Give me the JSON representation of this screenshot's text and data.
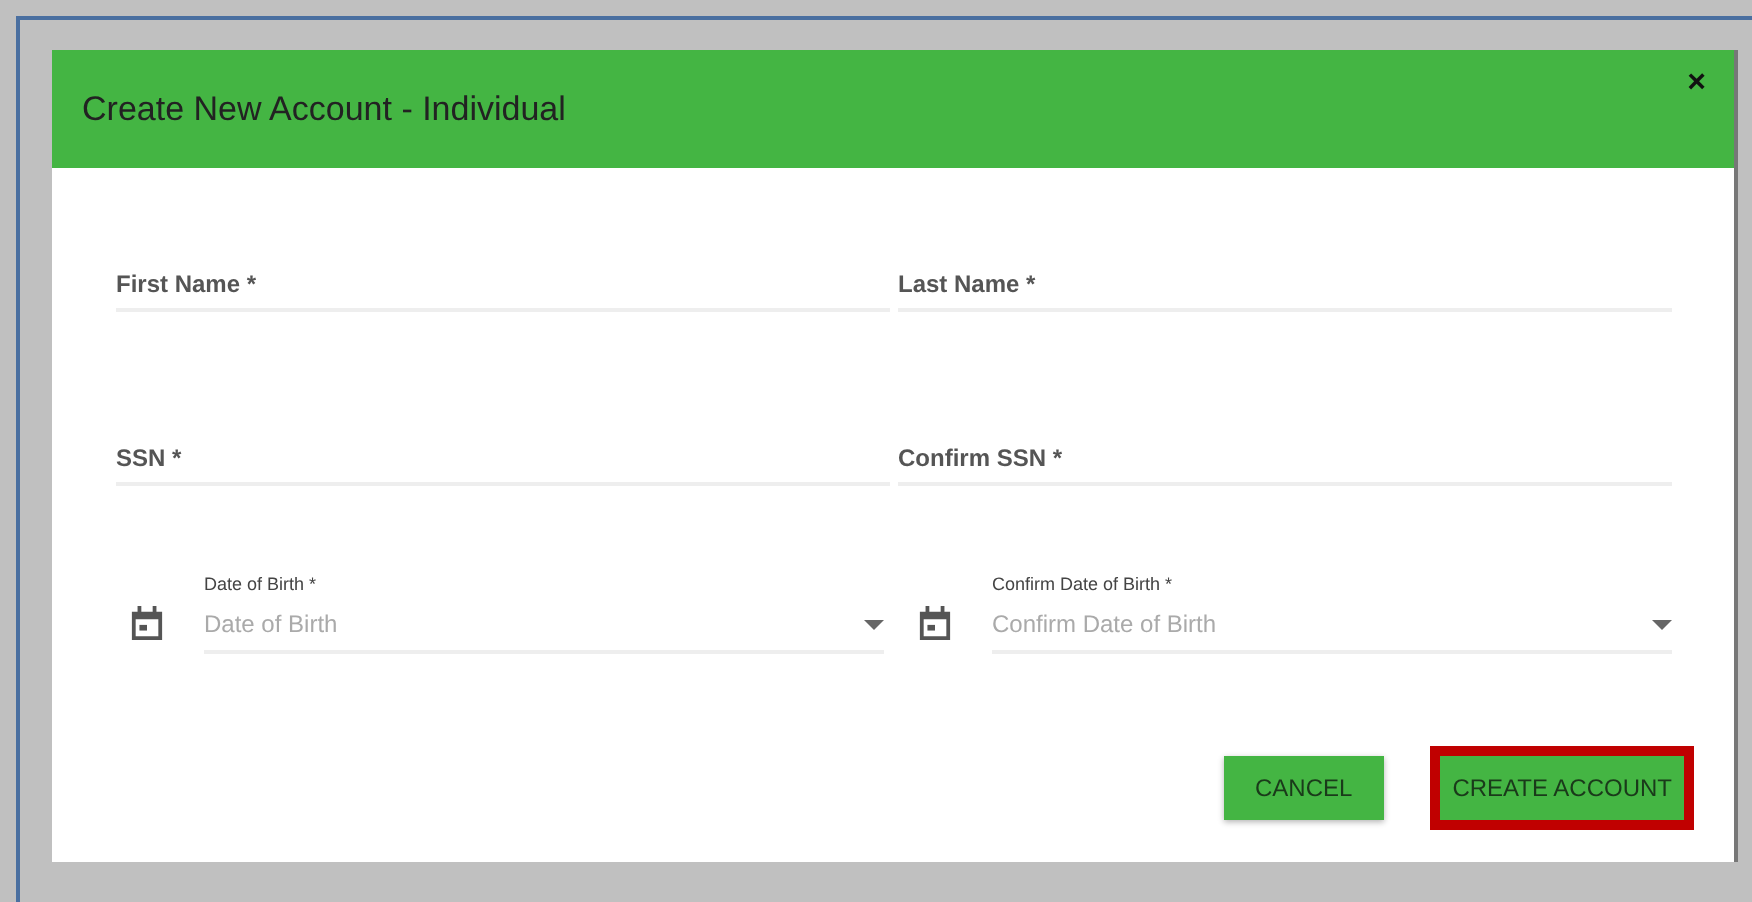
{
  "dialog": {
    "title": "Create New Account - Individual",
    "close": "×"
  },
  "text_fields": [
    {
      "placeholder": "First Name *"
    },
    {
      "placeholder": "Last Name *"
    },
    {
      "placeholder": "SSN *"
    },
    {
      "placeholder": "Confirm SSN *"
    }
  ],
  "date_fields": [
    {
      "label": "Date of Birth *",
      "placeholder": "Date of Birth"
    },
    {
      "label": "Confirm Date of Birth *",
      "placeholder": "Confirm Date of Birth"
    }
  ],
  "buttons": [
    {
      "label": "CANCEL",
      "highlighted": false
    },
    {
      "label": "CREATE ACCOUNT",
      "highlighted": true
    }
  ]
}
